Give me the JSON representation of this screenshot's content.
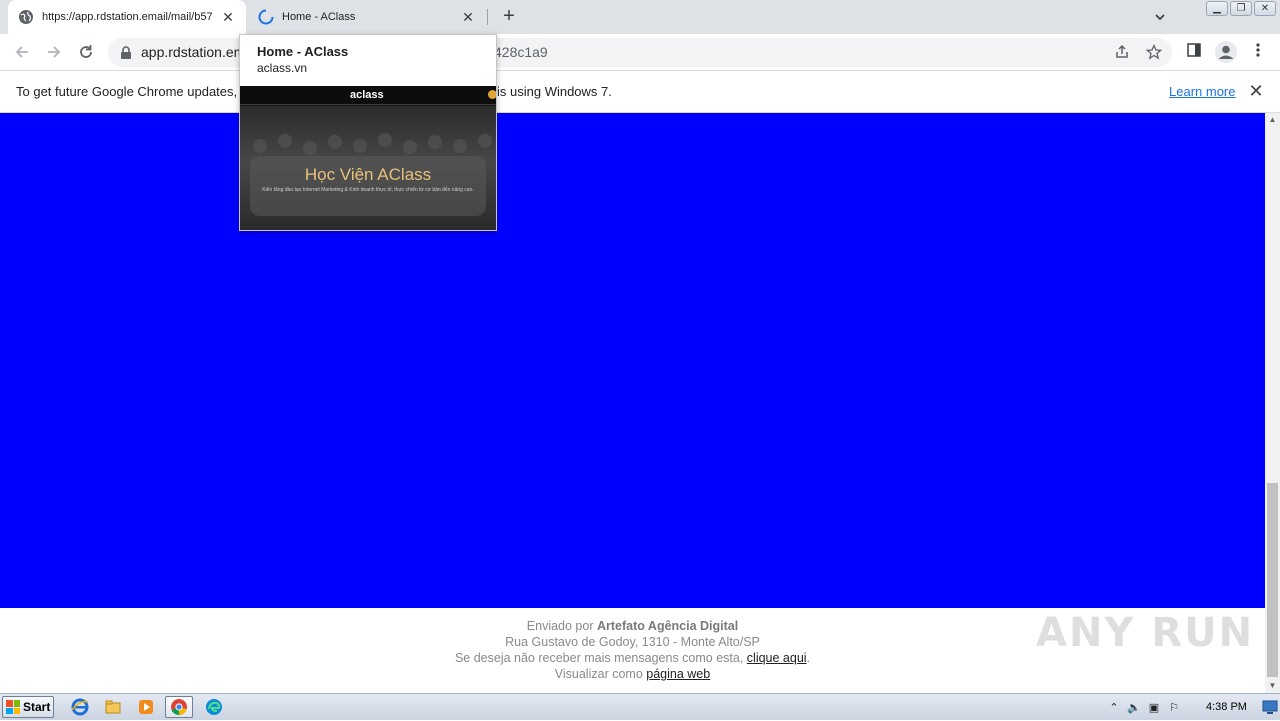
{
  "browser": {
    "tabs": [
      {
        "title": "https://app.rdstation.email/mail/b57",
        "active": true
      },
      {
        "title": "Home - AClass",
        "active": false,
        "loading": true
      }
    ],
    "new_tab_icon": "plus-icon",
    "url_visible": "app.rdstation.em",
    "url_tail": "428c1a9",
    "window_buttons": [
      "minimize",
      "restore",
      "close"
    ]
  },
  "infobar": {
    "text_start": "To get future Google Chrome updates, y",
    "text_end": "is using Windows 7.",
    "learn_more": "Learn more"
  },
  "tab_preview": {
    "title": "Home - AClass",
    "domain": "aclass.vn",
    "thumb_logo": "aclass",
    "thumb_headline": "Học Viện AClass",
    "thumb_subtext": "Kiến tăng đào tạo Internet Marketing & Kinh doanh thực tế, thực chiến từ cơ bản đến nâng cao."
  },
  "email": {
    "background_color": "#0000ff",
    "footer": {
      "sent_by_prefix": "Enviado por",
      "sender": "Artefato Agência Digital",
      "address": "Rua Gustavo de Godoy, 1310 - Monte Alto/SP",
      "unsubscribe_prefix": "Se deseja não receber mais mensagens como esta,",
      "unsubscribe_link": "clique aqui",
      "unsubscribe_suffix": ".",
      "view_prefix": "Visualizar como",
      "view_link": "página web"
    },
    "watermark": "ANY RUN"
  },
  "taskbar": {
    "start_label": "Start",
    "clock": "4:38 PM",
    "apps": [
      "ie-icon",
      "explorer-icon",
      "media-player-icon",
      "chrome-icon",
      "edge-icon"
    ]
  }
}
